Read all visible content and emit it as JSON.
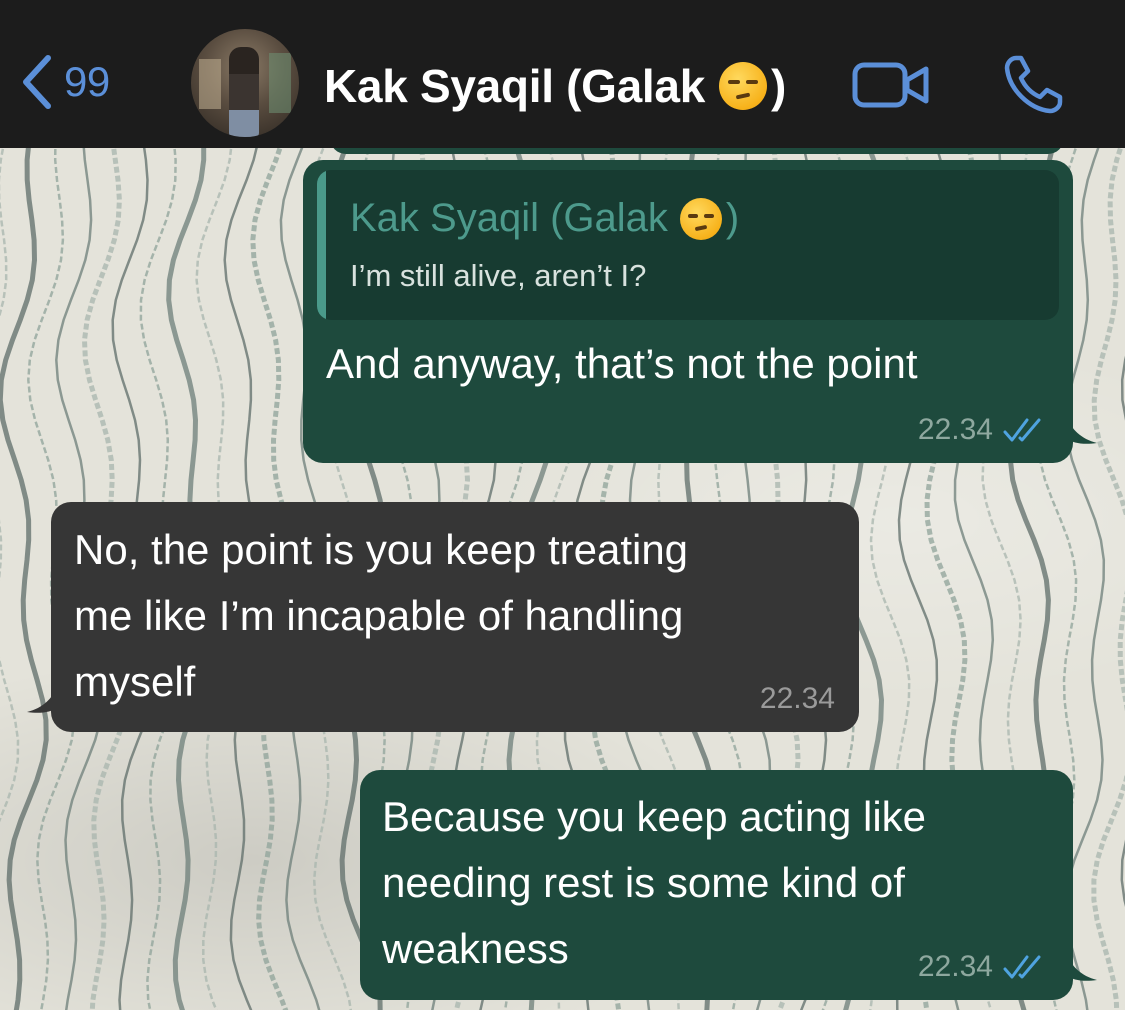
{
  "header": {
    "back_count": "99",
    "contact_name_prefix": "Kak Syaqil (Galak",
    "contact_name_suffix": ")",
    "icons": [
      "chevron-left-icon",
      "video-camera-icon",
      "phone-icon"
    ],
    "accent_color": "#5b8fd8"
  },
  "messages": [
    {
      "direction": "outgoing",
      "quote": {
        "author_prefix": "Kak Syaqil (Galak",
        "author_suffix": ")",
        "text": "I’m still alive, aren’t I?"
      },
      "lines": [
        "And anyway, that’s not the point"
      ],
      "time": "22.34",
      "status": "read"
    },
    {
      "direction": "incoming",
      "lines": [
        "No, the point is you keep treating",
        "me like I’m incapable of handling",
        "myself"
      ],
      "time": "22.34"
    },
    {
      "direction": "outgoing",
      "lines": [
        "Because you keep acting like",
        "needing rest is some kind of",
        "weakness"
      ],
      "time": "22.34",
      "status": "read"
    }
  ],
  "colors": {
    "outgoing_bubble": "#1e4a3d",
    "incoming_bubble": "#363636",
    "header_bg": "#1c1c1c",
    "read_ticks": "#4fa3e0"
  }
}
